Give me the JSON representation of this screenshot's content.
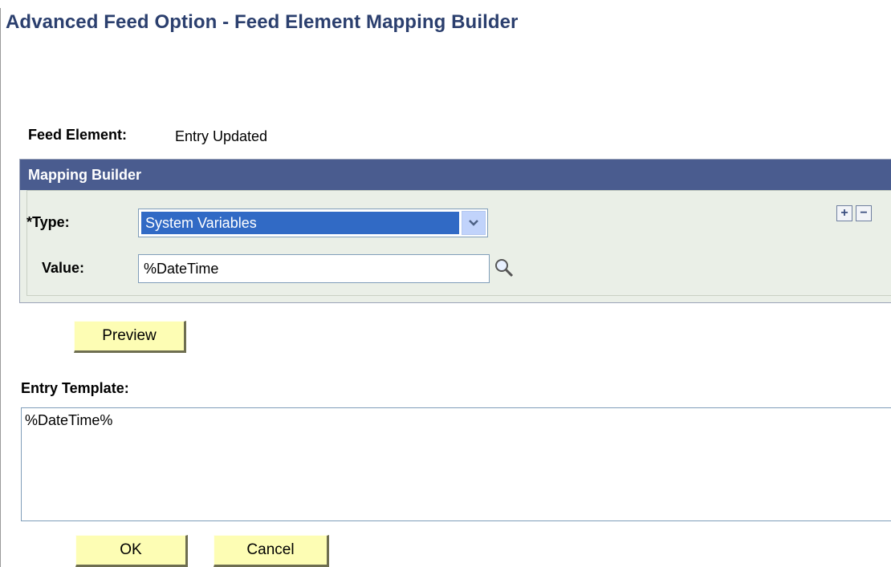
{
  "page": {
    "title": "Advanced Feed Option - Feed Element Mapping Builder"
  },
  "feed_element": {
    "label": "Feed Element:",
    "value": "Entry Updated"
  },
  "mapping_builder": {
    "header": "Mapping Builder",
    "type_label": "*Type:",
    "type_selected": "System Variables",
    "value_label": "Value:",
    "value": "%DateTime",
    "lookup_icon": "magnifier-icon",
    "add_row_icon": "plus-icon",
    "delete_row_icon": "minus-icon"
  },
  "preview_button": "Preview",
  "entry_template": {
    "label": "Entry Template:",
    "value": "%DateTime%"
  },
  "footer": {
    "ok_label": "OK",
    "cancel_label": "Cancel"
  },
  "colors": {
    "title": "#2b3f6e",
    "group_header_bg": "#4a5c8f",
    "group_bg": "#eaefe7",
    "selection_bg": "#316ac5",
    "button_bg": "#fdfdb4"
  }
}
